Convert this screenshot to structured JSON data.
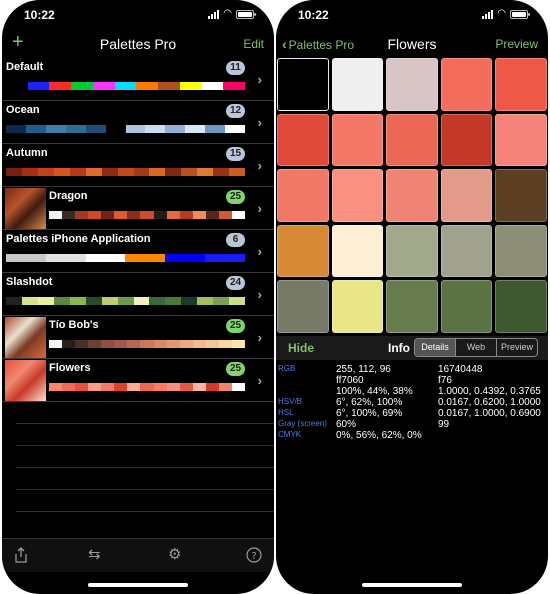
{
  "status": {
    "time": "10:22"
  },
  "left": {
    "title": "Palettes Pro",
    "add_icon": "plus-icon",
    "edit_label": "Edit",
    "palettes": [
      {
        "name": "Default",
        "count": "11",
        "badge_color": "#b8c6d8",
        "thumb": false,
        "colors": [
          "#000000",
          "#1f1fff",
          "#ff2a2a",
          "#00cc33",
          "#ff33ff",
          "#00e0ff",
          "#ff7a00",
          "#b05020",
          "#ffff00",
          "#ffffff",
          "#ff0066"
        ]
      },
      {
        "name": "Ocean",
        "count": "12",
        "badge_color": "#b8c6d8",
        "thumb": false,
        "colors": [
          "#0b2a4a",
          "#1d5e8e",
          "#3f7fae",
          "#2e6d96",
          "#1c4e78",
          "#000000",
          "#a8c6e0",
          "#c7dcee",
          "#8fb3d6",
          "#d9e8f4",
          "#6e98c2",
          "#ffffff"
        ]
      },
      {
        "name": "Autumn",
        "count": "15",
        "badge_color": "#b8c6d8",
        "thumb": false,
        "colors": [
          "#7a1f0e",
          "#a82d12",
          "#c4401a",
          "#d9531f",
          "#b83814",
          "#e06a2a",
          "#8e2a10",
          "#c24a18",
          "#a33a14",
          "#d96824",
          "#7e2a12",
          "#b85020",
          "#e07a30",
          "#9a3214",
          "#c95e22"
        ]
      },
      {
        "name": "Dragon",
        "count": "25",
        "badge_color": "#7fd46a",
        "thumb": true,
        "thumb_colors": [
          "#7a2a16",
          "#b8542a",
          "#3e1a10",
          "#d98a4a"
        ],
        "colors": [
          "#f2f2f2",
          "#3b2a22",
          "#a23a22",
          "#d4472a",
          "#6e2416",
          "#e25a34",
          "#8a2e1c",
          "#c84e2e",
          "#2a1a14",
          "#e86a44",
          "#b43c24",
          "#f08a5a",
          "#5a2418",
          "#d05a3a",
          "#ffffff"
        ]
      },
      {
        "name": "Palettes iPhone Application",
        "count": "6",
        "badge_color": "#b8c6d8",
        "thumb": false,
        "colors": [
          "#c8c8c8",
          "#e0e0e0",
          "#ffffff",
          "#ff8800",
          "#0000ff",
          "#1a1aff"
        ]
      },
      {
        "name": "Slashdot",
        "count": "24",
        "badge_color": "#b8c6d8",
        "thumb": false,
        "colors": [
          "#222222",
          "#d8e090",
          "#e8f0a0",
          "#5a8a3a",
          "#8ab84a",
          "#2a4a2a",
          "#b8d070",
          "#6a9a4a",
          "#f0f0c0",
          "#3a6a3a",
          "#4a7a3a",
          "#1a3a2a",
          "#a0c060",
          "#7aa050",
          "#c8e088"
        ]
      },
      {
        "name": "Tío Bob's",
        "count": "25",
        "badge_color": "#7fd46a",
        "thumb": true,
        "thumb_colors": [
          "#b84a2a",
          "#e8e0d0",
          "#7a3a22",
          "#d86a3a"
        ],
        "colors": [
          "#f4f4f4",
          "#2a1e1a",
          "#4a3028",
          "#6a4030",
          "#8a5040",
          "#a05a48",
          "#b86a50",
          "#c87a5a",
          "#d88a66",
          "#e09a72",
          "#e8aa7e",
          "#f0ba8a",
          "#f4c896",
          "#f8d6a2",
          "#fce4b0"
        ]
      },
      {
        "name": "Flowers",
        "count": "25",
        "badge_color": "#7fd46a",
        "thumb": true,
        "thumb_colors": [
          "#e8503a",
          "#f08a70",
          "#c8382a",
          "#ffe0d0"
        ],
        "colors": [
          "#ff8470",
          "#f26a5a",
          "#e8503a",
          "#ff9a88",
          "#f07a66",
          "#d8442e",
          "#ffaa96",
          "#e86a54",
          "#ff7a60",
          "#f49080",
          "#e25a44",
          "#ffb4a0",
          "#d23a2a",
          "#ee8470",
          "#ffffff"
        ]
      }
    ],
    "toolbar": {
      "share_icon": "share-icon",
      "swap_icon": "swap-arrows-icon",
      "settings_icon": "gear-icon",
      "help_icon": "help-icon"
    }
  },
  "right": {
    "back_label": "Palettes Pro",
    "title": "Flowers",
    "preview_label": "Preview",
    "swatches": [
      "#000000",
      "#efefef",
      "#d8c6c6",
      "#f46c5c",
      "#ee5846",
      "#e04a3a",
      "#f47868",
      "#ec6856",
      "#c43828",
      "#f4847a",
      "#f27868",
      "#fa9080",
      "#f08474",
      "#e49a8a",
      "#5c3e22",
      "#d68a36",
      "#fef0d4",
      "#a2a88c",
      "#a0a28e",
      "#8c8e76",
      "#767a66",
      "#e8e686",
      "#687c50",
      "#5a7244",
      "#3e5830"
    ],
    "selected_swatch": 0,
    "info": {
      "hide_label": "Hide",
      "info_label": "Info",
      "tabs": [
        "Details",
        "Web",
        "Preview"
      ],
      "active_tab": 0,
      "rows": [
        {
          "key": "RGB",
          "v1": "255, 112, 96",
          "v2": "16740448"
        },
        {
          "key": "",
          "v1": "ff7060",
          "v2": "f76"
        },
        {
          "key": "",
          "v1": "100%, 44%, 38%",
          "v2": "1.0000, 0.4392, 0.3765"
        },
        {
          "key": "HSV/B",
          "v1": "6°, 62%, 100%",
          "v2": "0.0167, 0.6200, 1.0000"
        },
        {
          "key": "HSL",
          "v1": "6°, 100%, 69%",
          "v2": "0.0167, 1.0000, 0.6900"
        },
        {
          "key": "Gray (screen)",
          "v1": "60%",
          "v2": "99"
        },
        {
          "key": "CMYK",
          "v1": "0%, 56%, 62%, 0%",
          "v2": ""
        }
      ]
    }
  }
}
